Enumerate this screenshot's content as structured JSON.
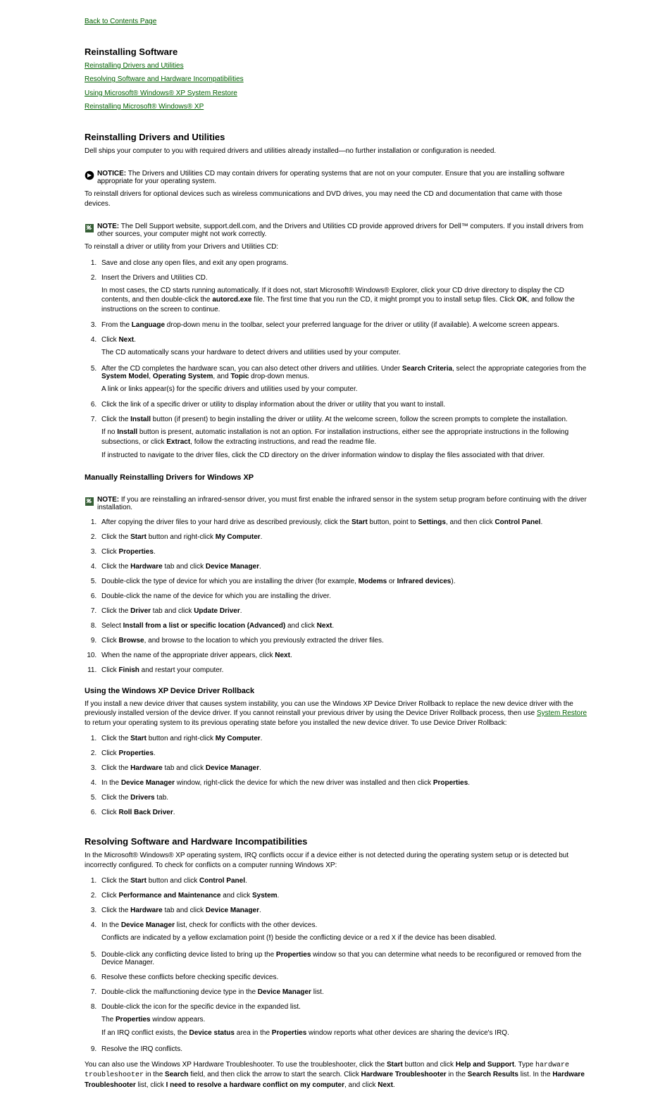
{
  "top_link": "Back to Contents Page",
  "h1a": "Reinstalling Software",
  "bullets_top": [
    "Reinstalling Drivers and Utilities",
    "Resolving Software and Hardware Incompatibilities",
    "Using Microsoft® Windows® XP System Restore",
    "Reinstalling Microsoft® Windows® XP"
  ],
  "h1b": "Reinstalling Drivers and Utilities",
  "para1": "Dell ships your computer to you with required drivers and utilities already installed—no further installation or configuration is needed.",
  "notice_bold": "NOTICE:",
  "notice_text": " The Drivers and Utilities CD may contain drivers for operating systems that are not on your computer. Ensure that you are installing software appropriate for your operating system.",
  "para2a": "To reinstall drivers for optional devices such as wireless communications and DVD drives, you may need the CD and documentation that came with those devices.",
  "note_bold": "NOTE:",
  "note_text1": " The Dell Support website, support.dell.com, and the Drivers and Utilities CD provide approved drivers for Dell™ computers. If you install drivers from other sources, your computer might not work correctly.",
  "para3": "To reinstall a driver or utility from your Drivers and Utilities CD:",
  "steps1": {
    "s1": "Save and close any open files, and exit any open programs.",
    "s2a": "Insert the Drivers and Utilities CD.",
    "s2b_1": "In most cases, the CD starts running automatically. If it does not, start Microsoft® Windows® Explorer, click your CD drive directory to display the CD contents, and then double-click the ",
    "s2b_bold": "autorcd.exe",
    "s2b_2": " file. The first time that you run the CD, it might prompt you to install setup files. Click ",
    "s2b_bold2": "OK",
    "s2b_3": ", and follow the instructions on the screen to continue.",
    "s3_1": "From the ",
    "s3_bold1": "Language",
    "s3_2": " drop-down menu in the toolbar, select your preferred language for the driver or utility (if available). A welcome screen appears.",
    "s4_1": "Click ",
    "s4_bold": "Next",
    "s4_2": ".",
    "s4_p": "The CD automatically scans your hardware to detect drivers and utilities used by your computer.",
    "s5_1": "After the CD completes the hardware scan, you can also detect other drivers and utilities. Under ",
    "s5_b1": "Search Criteria",
    "s5_2": ", select the appropriate categories from the ",
    "s5_b2": "System Model",
    "s5_3": ", ",
    "s5_b3": "Operating System",
    "s5_4": ", and ",
    "s5_b4": "Topic",
    "s5_5": " drop-down menus.",
    "s5_p": "A link or links appear(s) for the specific drivers and utilities used by your computer.",
    "s6": "Click the link of a specific driver or utility to display information about the driver or utility that you want to install.",
    "s7_1": "Click the ",
    "s7_b": "Install",
    "s7_2": " button (if present) to begin installing the driver or utility. At the welcome screen, follow the screen prompts to complete the installation.",
    "s7_p1_1": "If no ",
    "s7_p1_b": "Install",
    "s7_p1_2": " button is present, automatic installation is not an option. For installation instructions, either see the appropriate instructions in the following subsections, or click ",
    "s7_p1_b2": "Extract",
    "s7_p1_3": ", follow the extracting instructions, and read the readme file.",
    "s7_p2": "If instructed to navigate to the driver files, click the CD directory on the driver information window to display the files associated with that driver."
  },
  "h2a": "Manually Reinstalling Drivers for Windows XP",
  "note_text2": " If you are reinstalling an infrared-sensor driver, you must first enable the infrared sensor in the system setup program before continuing with the driver installation.",
  "steps2": {
    "s1_1": "After copying the driver files to your hard drive as described previously, click the ",
    "s1_b1": "Start",
    "s1_2": " button, point to ",
    "s1_b2": "Settings",
    "s1_3": ", and then click ",
    "s1_b3": "Control Panel",
    "s1_4": ".",
    "s2_1": "Click the ",
    "s2_b1": "Start",
    "s2_2": " button and right-click ",
    "s2_b2": "My Computer",
    "s2_3": ".",
    "s3_1": "Click ",
    "s3_b1": "Properties",
    "s3_2": ".",
    "s4_1": "Click the ",
    "s4_b1": "Hardware",
    "s4_2": " tab and click ",
    "s4_b2": "Device Manager",
    "s4_3": ".",
    "s5_1": "Double-click the type of device for which you are installing the driver (for example, ",
    "s5_b1": "Modems",
    "s5_2": " or ",
    "s5_b2": "Infrared devices",
    "s5_3": ").",
    "s6": "Double-click the name of the device for which you are installing the driver.",
    "s7_1": "Click the ",
    "s7_b1": "Driver",
    "s7_2": " tab and click ",
    "s7_b2": "Update Driver",
    "s7_3": ".",
    "s8_1": "Select ",
    "s8_b1": "Install from a list or specific location (Advanced)",
    "s8_2": " and click ",
    "s8_b2": "Next",
    "s8_3": ".",
    "s9_1": "Click ",
    "s9_b1": "Browse",
    "s9_2": ", and browse to the location to which you previously extracted the driver files.",
    "s10_1": "When the name of the appropriate driver appears, click ",
    "s10_b1": "Next",
    "s10_2": ".",
    "s11_1": "Click ",
    "s11_b1": "Finish",
    "s11_2": " and restart your computer."
  },
  "h2b": "Using the Windows XP Device Driver Rollback",
  "para_ddr": "If you install a new device driver that causes system instability, you can use the Windows XP Device Driver Rollback to replace the new device driver with the previously installed version of the device driver. If you cannot reinstall your previous driver by using the Device Driver Rollback process, then use ",
  "para_ddr_link": "System Restore",
  "para_ddr_2": " to return your operating system to its previous operating state before you installed the new device driver. To use Device Driver Rollback:",
  "steps3": {
    "s1_1": "Click the ",
    "s1_b1": "Start",
    "s1_2": " button and right-click ",
    "s1_b2": "My Computer",
    "s1_3": ".",
    "s2_1": "Click ",
    "s2_b1": "Properties",
    "s2_2": ".",
    "s3_1": "Click the ",
    "s3_b1": "Hardware",
    "s3_2": " tab and click ",
    "s3_b2": "Device Manager",
    "s3_3": ".",
    "s4_1": "In the ",
    "s4_b1": "Device Manager",
    "s4_2": " window, right-click the device for which the new driver was installed and then click ",
    "s4_b2": "Properties",
    "s4_3": ".",
    "s5_1": "Click the ",
    "s5_b1": "Drivers",
    "s5_2": " tab.",
    "s6_1": "Click ",
    "s6_b1": "Roll Back Driver",
    "s6_2": "."
  },
  "h1c": "Resolving Software and Hardware Incompatibilities",
  "para_incompat": "In the Microsoft® Windows® XP operating system, IRQ conflicts occur if a device either is not detected during the operating system setup or is detected but incorrectly configured. To check for conflicts on a computer running Windows XP:",
  "steps4": {
    "s1_1": "Click the ",
    "s1_b1": "Start",
    "s1_2": " button and click ",
    "s1_b2": "Control Panel",
    "s1_3": ".",
    "s2_1": "Click ",
    "s2_b1": "Performance and Maintenance",
    "s2_2": " and click ",
    "s2_b2": "System",
    "s2_3": ".",
    "s3_1": "Click the ",
    "s3_b1": "Hardware",
    "s3_2": " tab and click ",
    "s3_b2": "Device Manager",
    "s3_3": ".",
    "s4_1": "In the ",
    "s4_b1": "Device Manager",
    "s4_2": " list, check for conflicts with the other devices.",
    "s4_p_1": "Conflicts are indicated by a yellow exclamation point (",
    "s4_p_b": "!",
    "s4_p_2": ") beside the conflicting device or a red ",
    "s4_p_x": "X",
    "s4_p_3": " if the device has been disabled.",
    "s5_1": "Double-click any conflicting device listed to bring up the ",
    "s5_b1": "Properties",
    "s5_2": " window so that you can determine what needs to be reconfigured or removed from the Device Manager.",
    "s6": "Resolve these conflicts before checking specific devices.",
    "s7_1": "Double-click the malfunctioning device type in the ",
    "s7_b1": "Device Manager",
    "s7_2": " list.",
    "s8": "Double-click the icon for the specific device in the expanded list.",
    "s8_p_1": "The ",
    "s8_p_b": "Properties",
    "s8_p_2": " window appears.",
    "s8_p2_1": "If an IRQ conflict exists, the ",
    "s8_p2_b": "Device status",
    "s8_p2_2": " area in the ",
    "s8_p2_b2": "Properties",
    "s8_p2_3": " window reports what other devices are sharing the device's IRQ.",
    "s9": "Resolve the IRQ conflicts."
  },
  "para_ts_1": "You can also use the Windows XP Hardware Troubleshooter. To use the troubleshooter, click the ",
  "para_ts_b1": "Start",
  "para_ts_2": " button and click ",
  "para_ts_b2": "Help and Support",
  "para_ts_3": ". Type ",
  "para_ts_code": "hardware troubleshooter",
  "para_ts_4": " in the ",
  "para_ts_b3": "Search",
  "para_ts_5": " field, and then click the arrow to start the search. Click ",
  "para_ts_b4": "Hardware Troubleshooter",
  "para_ts_6": " in the ",
  "para_ts_b5": "Search Results",
  "para_ts_7": " list. In the ",
  "para_ts_b6": "Hardware Troubleshooter",
  "para_ts_8": " list, click ",
  "para_ts_b7": "I need to resolve a hardware conflict on my computer",
  "para_ts_9": ", and click ",
  "para_ts_b8": "Next",
  "para_ts_10": "."
}
